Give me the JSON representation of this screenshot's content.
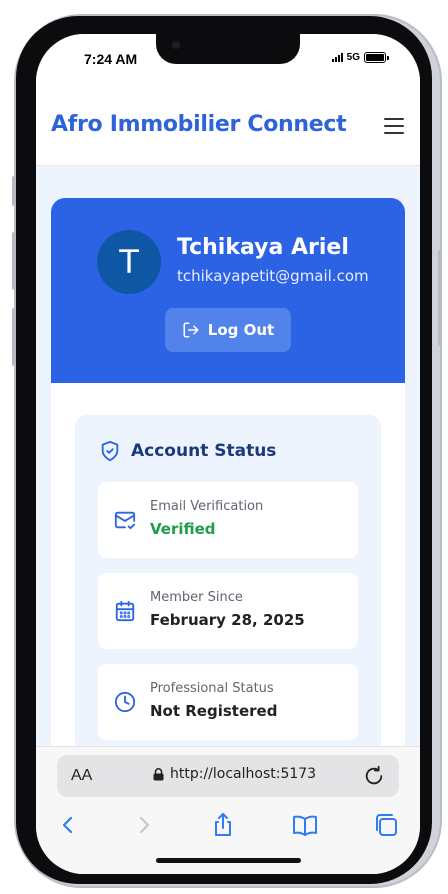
{
  "status_bar": {
    "time": "7:24 AM",
    "network": "5G"
  },
  "app": {
    "brand": "Afro Immobilier Connect"
  },
  "profile": {
    "avatar_initial": "T",
    "name": "Tchikaya Ariel",
    "email": "tchikayapetit@gmail.com",
    "logout_label": "Log Out"
  },
  "account_status": {
    "title": "Account Status",
    "items": [
      {
        "label": "Email Verification",
        "value": "Verified",
        "icon": "mail-check-icon"
      },
      {
        "label": "Member Since",
        "value": "February 28, 2025",
        "icon": "calendar-icon"
      },
      {
        "label": "Professional Status",
        "value": "Not Registered",
        "icon": "clock-icon"
      }
    ]
  },
  "browser": {
    "text_size_label": "AA",
    "url": "http://localhost:5173"
  },
  "colors": {
    "brand": "#2f64d8",
    "hero": "#2c63e5",
    "verified": "#1f9d48",
    "panel_bg": "#eef4fe"
  }
}
